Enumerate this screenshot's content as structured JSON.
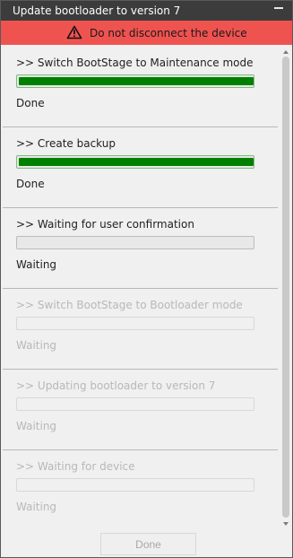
{
  "window": {
    "title": "Update bootloader to version 7"
  },
  "warning": {
    "text": "Do not disconnect the device",
    "color": "#ef5350"
  },
  "steps": [
    {
      "label": ">> Switch BootStage to Maintenance mode",
      "status": "Done",
      "progress": 1,
      "state": "complete"
    },
    {
      "label": ">> Create backup",
      "status": "Done",
      "progress": 1,
      "state": "complete"
    },
    {
      "label": ">> Waiting for user confirmation",
      "status": "Waiting",
      "progress": 0,
      "state": "active"
    },
    {
      "label": ">> Switch BootStage to Bootloader mode",
      "status": "Waiting",
      "progress": 0,
      "state": "disabled"
    },
    {
      "label": ">> Updating bootloader to version 7",
      "status": "Waiting",
      "progress": 0,
      "state": "disabled"
    },
    {
      "label": ">> Waiting for device",
      "status": "Waiting",
      "progress": 0,
      "state": "disabled"
    }
  ],
  "footer": {
    "button_label": "Done"
  },
  "icons": {
    "minimize": "minimize-icon",
    "warning": "warning-triangle-icon"
  },
  "colors": {
    "progress_fill": "#008000",
    "titlebar": "#3c3c3c"
  }
}
